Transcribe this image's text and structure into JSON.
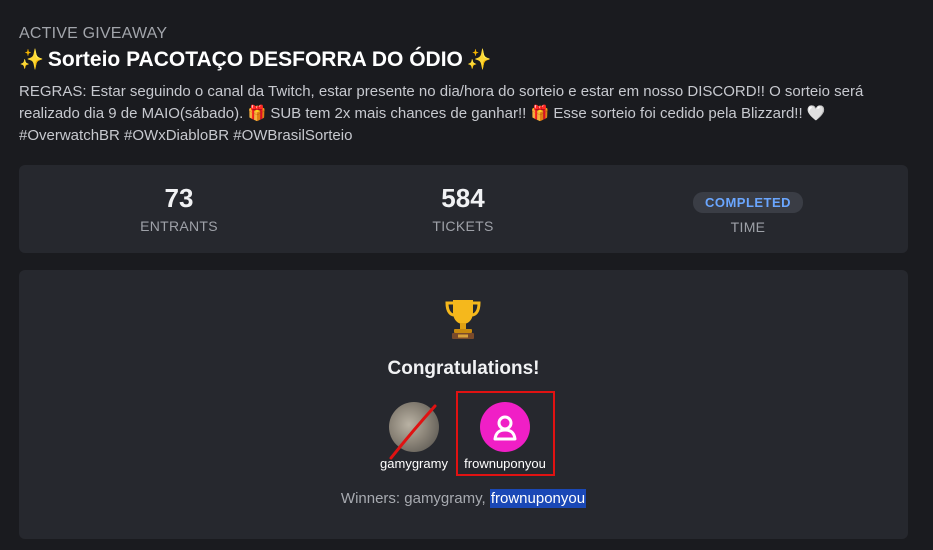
{
  "header": {
    "eyebrow": "ACTIVE GIVEAWAY",
    "title_icon_left": "✨",
    "title": "Sorteio PACOTAÇO DESFORRA DO ÓDIO",
    "title_icon_right": "✨",
    "rules_part1": "REGRAS: Estar seguindo o canal da Twitch, estar presente no dia/hora do sorteio e estar em nosso DISCORD!! O sorteio será realizado dia 9 de MAIO(sábado). ",
    "gift_icon": "🎁",
    "rules_part2": " SUB tem 2x mais chances de ganhar!! ",
    "rules_part3": " Esse sorteio foi cedido pela Blizzard!! ",
    "heart_icon": "🤍",
    "rules_part4": " #OverwatchBR #OWxDiabloBR #OWBrasilSorteio"
  },
  "stats": {
    "entrants_value": "73",
    "entrants_label": "ENTRANTS",
    "tickets_value": "584",
    "tickets_label": "TICKETS",
    "status_badge": "COMPLETED",
    "time_label": "TIME"
  },
  "winners": {
    "trophy_icon": "trophy-icon",
    "congrats": "Congratulations!",
    "list": [
      {
        "name": "gamygramy",
        "struck": true
      },
      {
        "name": "frownuponyou",
        "highlighted": true
      }
    ],
    "summary_prefix": "Winners: gamygramy, ",
    "summary_highlight": "frownuponyou"
  },
  "colors": {
    "accent_badge": "#6aa6ff",
    "avatar_pink": "#f01fc6",
    "highlight_box": "#e01212",
    "selection": "#1a48b6"
  }
}
